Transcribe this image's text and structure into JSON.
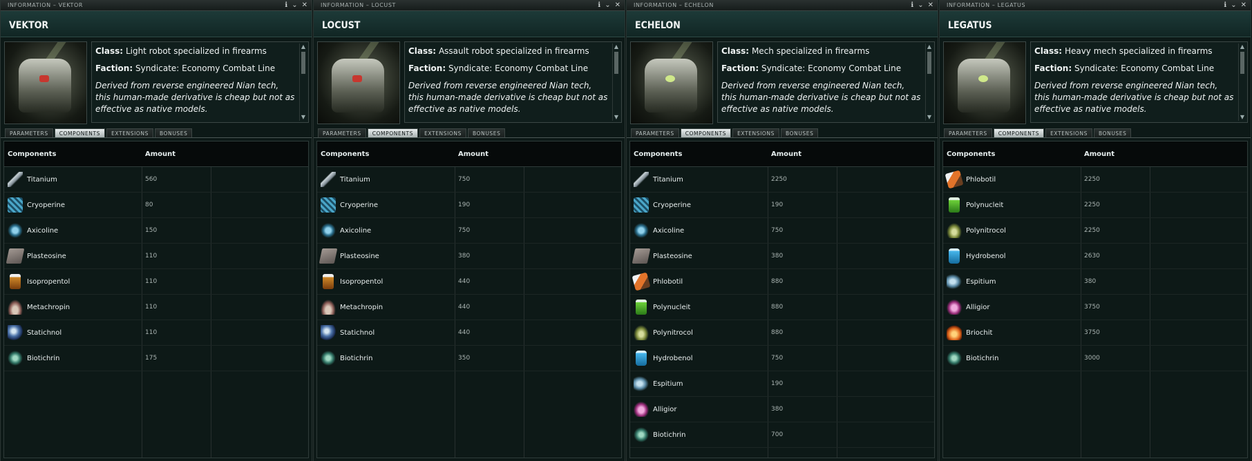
{
  "labels": {
    "class": "Class:",
    "faction": "Faction:"
  },
  "window_controls": {
    "info": "ℹ",
    "collapse": "⌄",
    "close": "✕"
  },
  "tabs": [
    "PARAMETERS",
    "COMPONENTS",
    "EXTENSIONS",
    "BONUSES"
  ],
  "columns": {
    "components": "Components",
    "amount": "Amount"
  },
  "panels": [
    {
      "title": "INFORMATION – VEKTOR",
      "name": "VEKTOR",
      "class": "Light robot specialized in firearms",
      "faction": "Syndicate: Economy Combat Line",
      "flavor": "Derived from reverse engineered Nian tech, this human-made derivative is cheap but not as effective as native models.",
      "components": [
        {
          "name": "Titanium",
          "amount": "560",
          "icon": "titanium-icon"
        },
        {
          "name": "Cryoperine",
          "amount": "80",
          "icon": "cryoperine-icon"
        },
        {
          "name": "Axicoline",
          "amount": "150",
          "icon": "axicoline-icon"
        },
        {
          "name": "Plasteosine",
          "amount": "110",
          "icon": "plasteosine-icon"
        },
        {
          "name": "Isopropentol",
          "amount": "110",
          "icon": "isopropentol-icon"
        },
        {
          "name": "Metachropin",
          "amount": "110",
          "icon": "metachropin-icon"
        },
        {
          "name": "Statichnol",
          "amount": "110",
          "icon": "statichnol-icon"
        },
        {
          "name": "Biotichrin",
          "amount": "175",
          "icon": "biotichrin-icon"
        }
      ]
    },
    {
      "title": "INFORMATION – LOCUST",
      "name": "LOCUST",
      "class": "Assault robot specialized in firearms",
      "faction": "Syndicate: Economy Combat Line",
      "flavor": "Derived from reverse engineered Nian tech, this human-made derivative is cheap but not as effective as native models.",
      "components": [
        {
          "name": "Titanium",
          "amount": "750",
          "icon": "titanium-icon"
        },
        {
          "name": "Cryoperine",
          "amount": "190",
          "icon": "cryoperine-icon"
        },
        {
          "name": "Axicoline",
          "amount": "750",
          "icon": "axicoline-icon"
        },
        {
          "name": "Plasteosine",
          "amount": "380",
          "icon": "plasteosine-icon"
        },
        {
          "name": "Isopropentol",
          "amount": "440",
          "icon": "isopropentol-icon"
        },
        {
          "name": "Metachropin",
          "amount": "440",
          "icon": "metachropin-icon"
        },
        {
          "name": "Statichnol",
          "amount": "440",
          "icon": "statichnol-icon"
        },
        {
          "name": "Biotichrin",
          "amount": "350",
          "icon": "biotichrin-icon"
        }
      ]
    },
    {
      "title": "INFORMATION – ECHELON",
      "name": "ECHELON",
      "class": "Mech specialized in firearms",
      "faction": "Syndicate: Economy Combat Line",
      "flavor": "Derived from reverse engineered Nian tech, this human-made derivative is cheap but not as effective as native models.",
      "components": [
        {
          "name": "Titanium",
          "amount": "2250",
          "icon": "titanium-icon"
        },
        {
          "name": "Cryoperine",
          "amount": "190",
          "icon": "cryoperine-icon"
        },
        {
          "name": "Axicoline",
          "amount": "750",
          "icon": "axicoline-icon"
        },
        {
          "name": "Plasteosine",
          "amount": "380",
          "icon": "plasteosine-icon"
        },
        {
          "name": "Phlobotil",
          "amount": "880",
          "icon": "phlobotil-icon"
        },
        {
          "name": "Polynucleit",
          "amount": "880",
          "icon": "polynucleit-icon"
        },
        {
          "name": "Polynitrocol",
          "amount": "880",
          "icon": "polynitrocol-icon"
        },
        {
          "name": "Hydrobenol",
          "amount": "750",
          "icon": "hydrobenol-icon"
        },
        {
          "name": "Espitium",
          "amount": "190",
          "icon": "espitium-icon"
        },
        {
          "name": "Alligior",
          "amount": "380",
          "icon": "alligior-icon"
        },
        {
          "name": "Biotichrin",
          "amount": "700",
          "icon": "biotichrin-icon"
        }
      ]
    },
    {
      "title": "INFORMATION – LEGATUS",
      "name": "LEGATUS",
      "class": "Heavy mech specialized in firearms",
      "faction": "Syndicate: Economy Combat Line",
      "flavor": "Derived from reverse engineered Nian tech, this human-made derivative is cheap but not as effective as native models.",
      "components": [
        {
          "name": "Phlobotil",
          "amount": "2250",
          "icon": "phlobotil-icon"
        },
        {
          "name": "Polynucleit",
          "amount": "2250",
          "icon": "polynucleit-icon"
        },
        {
          "name": "Polynitrocol",
          "amount": "2250",
          "icon": "polynitrocol-icon"
        },
        {
          "name": "Hydrobenol",
          "amount": "2630",
          "icon": "hydrobenol-icon"
        },
        {
          "name": "Espitium",
          "amount": "380",
          "icon": "espitium-icon"
        },
        {
          "name": "Alligior",
          "amount": "3750",
          "icon": "alligior-icon"
        },
        {
          "name": "Briochit",
          "amount": "3750",
          "icon": "briochit-icon"
        },
        {
          "name": "Biotichrin",
          "amount": "3000",
          "icon": "biotichrin-icon"
        }
      ]
    }
  ]
}
